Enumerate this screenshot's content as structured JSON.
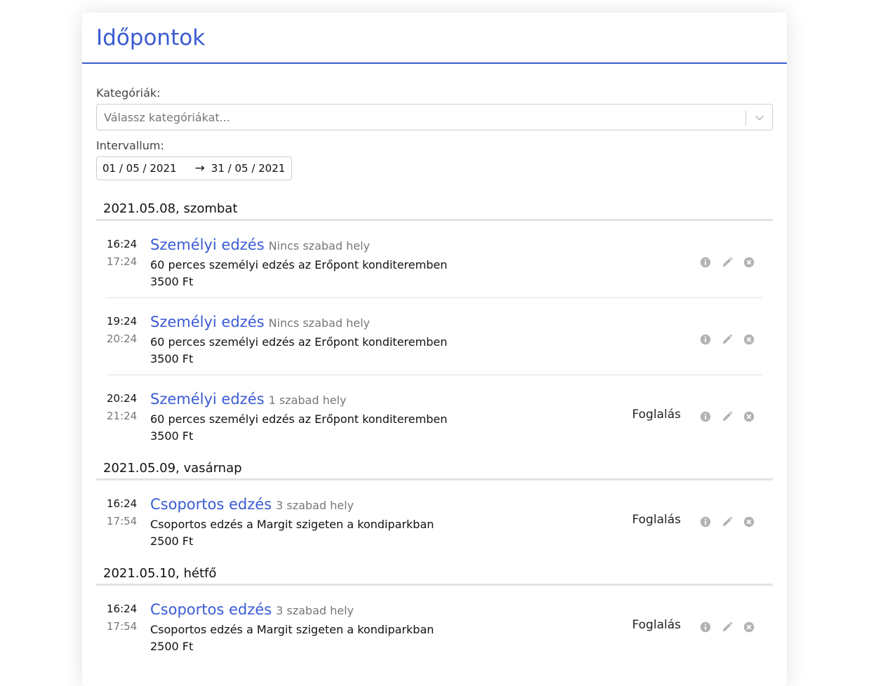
{
  "page": {
    "title": "Időpontok"
  },
  "filters": {
    "categories_label": "Kategóriák:",
    "categories_placeholder": "Válassz kategóriákat...",
    "interval_label": "Intervallum:",
    "date_from": "01 / 05 / 2021",
    "date_arrow": "→",
    "date_to": "31 / 05 / 2021"
  },
  "days": [
    {
      "heading": "2021.05.08, szombat",
      "slots": [
        {
          "start": "16:24",
          "end": "17:24",
          "title": "Személyi edzés",
          "availability": "Nincs szabad hely",
          "description": "60 perces személyi edzés az Erőpont konditeremben",
          "price": "3500 Ft",
          "book_label": ""
        },
        {
          "start": "19:24",
          "end": "20:24",
          "title": "Személyi edzés",
          "availability": "Nincs szabad hely",
          "description": "60 perces személyi edzés az Erőpont konditeremben",
          "price": "3500 Ft",
          "book_label": ""
        },
        {
          "start": "20:24",
          "end": "21:24",
          "title": "Személyi edzés",
          "availability": "1 szabad hely",
          "description": "60 perces személyi edzés az Erőpont konditeremben",
          "price": "3500 Ft",
          "book_label": "Foglalás"
        }
      ]
    },
    {
      "heading": "2021.05.09, vasárnap",
      "slots": [
        {
          "start": "16:24",
          "end": "17:54",
          "title": "Csoportos edzés",
          "availability": "3 szabad hely",
          "description": "Csoportos edzés a Margit szigeten a kondiparkban",
          "price": "2500 Ft",
          "book_label": "Foglalás"
        }
      ]
    },
    {
      "heading": "2021.05.10, hétfő",
      "slots": [
        {
          "start": "16:24",
          "end": "17:54",
          "title": "Csoportos edzés",
          "availability": "3 szabad hely",
          "description": "Csoportos edzés a Margit szigeten a kondiparkban",
          "price": "2500 Ft",
          "book_label": "Foglalás"
        }
      ]
    }
  ],
  "colors": {
    "accent": "#3a5bd4",
    "icon": "#b3b3b3"
  },
  "icons": {
    "info": "info-icon",
    "edit": "pencil-icon",
    "delete": "close-circle-icon",
    "dropdown": "chevron-down-icon"
  }
}
